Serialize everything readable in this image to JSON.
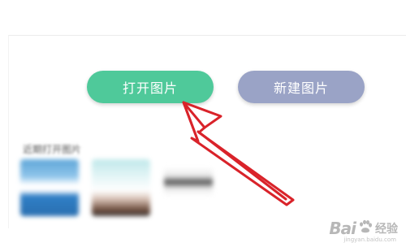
{
  "actions": {
    "open_image_label": "打开图片",
    "new_image_label": "新建图片"
  },
  "recent": {
    "label": "近期打开图片"
  },
  "annotation": {
    "arrow_color": "#d9232a",
    "arrow_points_to": "open-image-button"
  },
  "watermark": {
    "brand": "Bai",
    "paw": "du",
    "sub": "经验",
    "url": "jingyan.baidu.com"
  },
  "colors": {
    "open_button": "#4fc99a",
    "new_button": "#9aa3c6"
  }
}
